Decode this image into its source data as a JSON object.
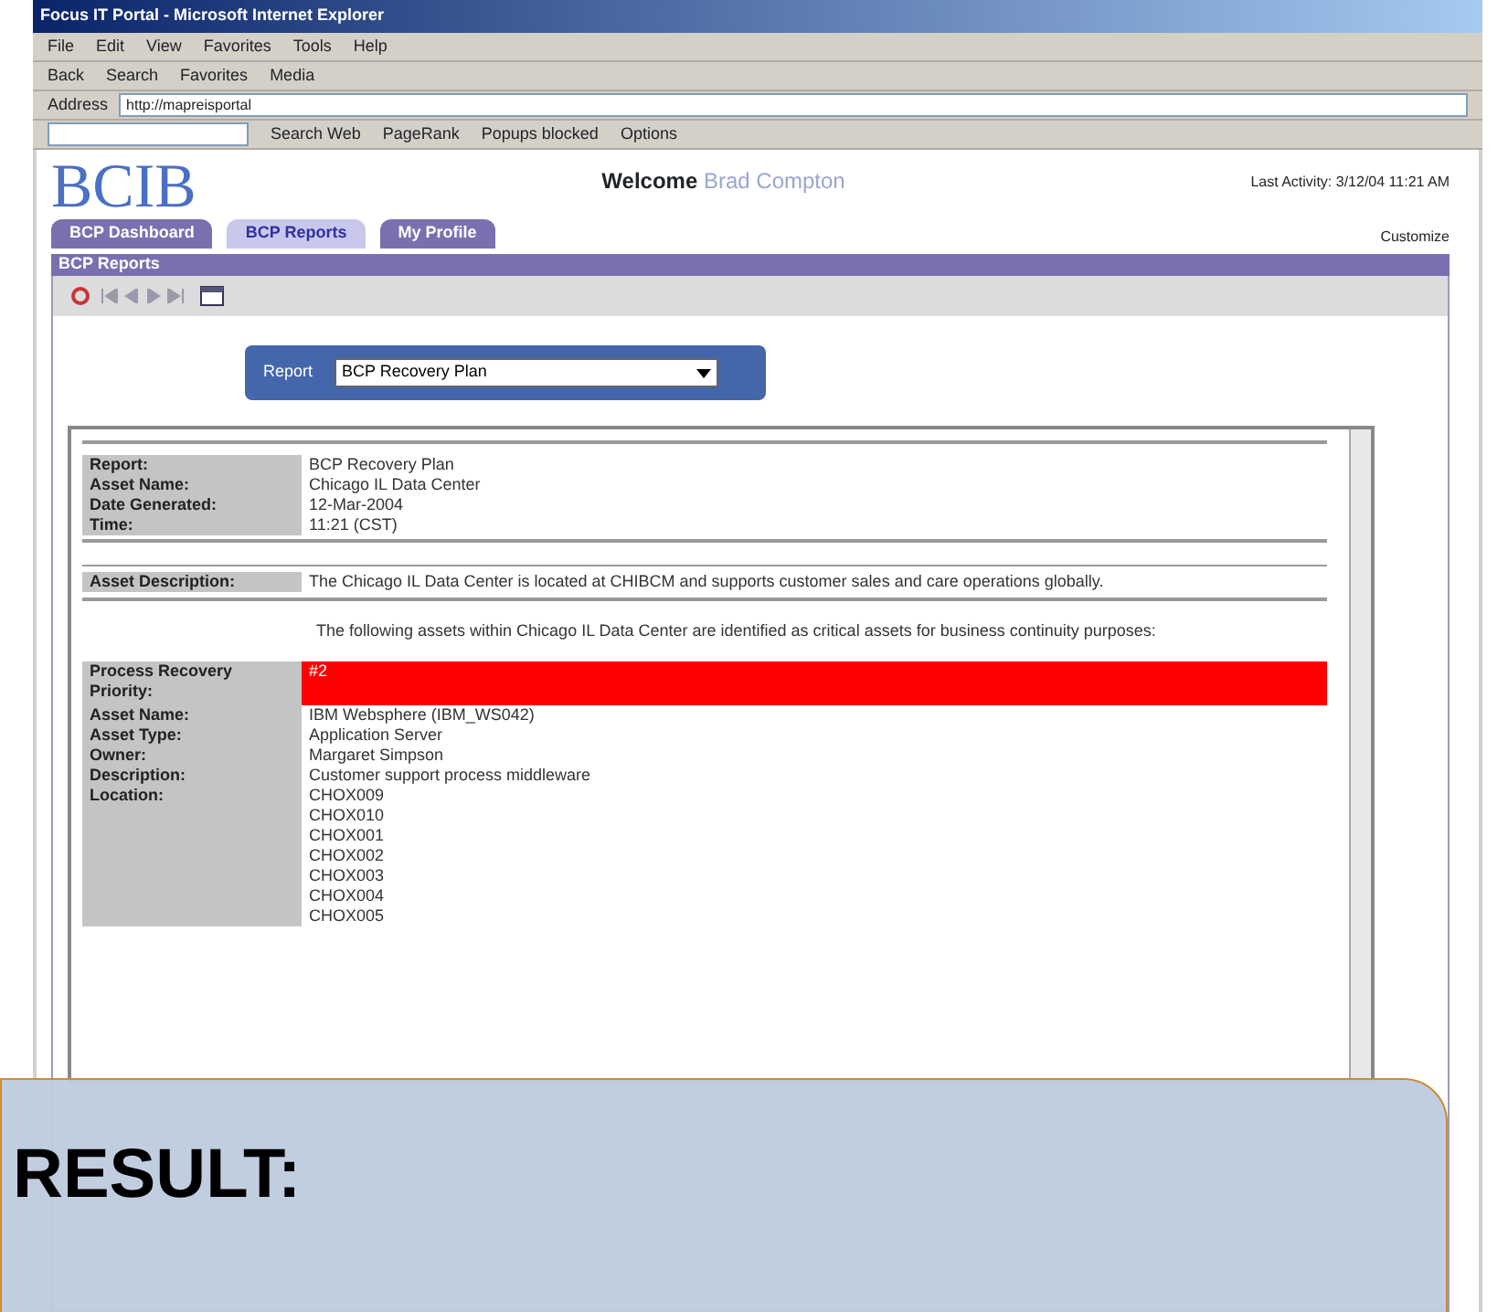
{
  "window": {
    "title": "Focus IT Portal - Microsoft Internet Explorer"
  },
  "menu": [
    "File",
    "Edit",
    "View",
    "Favorites",
    "Tools",
    "Help"
  ],
  "toolbar": [
    "Back",
    "Search",
    "Favorites",
    "Media"
  ],
  "address": {
    "label": "Address",
    "url": "http://mapreisportal"
  },
  "google_toolbar": [
    "Search Web",
    "PageRank",
    "Popups blocked",
    "Options"
  ],
  "portal": {
    "logo": "BCIB",
    "welcome_label": "Welcome",
    "user": "Brad Compton",
    "last_activity": "Last Activity: 3/12/04 11:21 AM",
    "tabs": [
      {
        "label": "BCP Dashboard",
        "selected": false
      },
      {
        "label": "BCP Reports",
        "selected": true
      },
      {
        "label": "My Profile",
        "selected": false
      }
    ],
    "customize": "Customize",
    "panel_title": "BCP Reports",
    "report_label": "Report",
    "report_value": "BCP Recovery Plan",
    "header_fields": [
      {
        "label": "Report:",
        "value": "BCP Recovery Plan"
      },
      {
        "label": "Asset Name:",
        "value": "Chicago IL Data Center"
      },
      {
        "label": "Date Generated:",
        "value": "12-Mar-2004"
      },
      {
        "label": "Time:",
        "value": "11:21 (CST)"
      }
    ],
    "asset_description": {
      "label": "Asset Description:",
      "value": "The Chicago IL Data Center is located at CHIBCM and supports customer sales and care operations globally."
    },
    "intro": "The following assets within Chicago IL Data Center are identified as critical assets for business continuity purposes:",
    "asset_fields": [
      {
        "label": "Process Recovery Priority:",
        "values": [
          "#2"
        ],
        "color": "#ff0000"
      },
      {
        "label": "Asset Name:",
        "values": [
          "IBM Websphere (IBM_WS042)"
        ]
      },
      {
        "label": "Asset Type:",
        "values": [
          "Application Server"
        ]
      },
      {
        "label": "Owner:",
        "values": [
          "Margaret Simpson"
        ]
      },
      {
        "label": "Description:",
        "values": [
          "Customer support process middleware"
        ]
      },
      {
        "label": "Location:",
        "values": [
          "CHOX009",
          "CHOX010",
          "CHOX001",
          "CHOX002",
          "CHOX003",
          "CHOX004",
          "CHOX005"
        ]
      }
    ]
  },
  "overlay": {
    "text": "RESULT:"
  }
}
